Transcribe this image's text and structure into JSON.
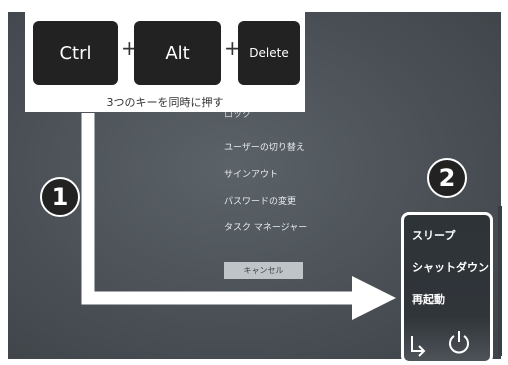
{
  "keys": {
    "ctrl": "Ctrl",
    "alt": "Alt",
    "delete": "Delete",
    "plus1": "+",
    "plus2": "+",
    "caption": "3つのキーを同時に押す"
  },
  "menu": {
    "items": [
      {
        "label": "ロック"
      },
      {
        "label": "ユーザーの切り替え"
      },
      {
        "label": "サインアウト"
      },
      {
        "label": "パスワードの変更"
      },
      {
        "label": "タスク マネージャー"
      }
    ],
    "cancel_label": "キャンセル"
  },
  "power_menu": {
    "items": [
      {
        "label": "スリープ"
      },
      {
        "label": "シャットダウン"
      },
      {
        "label": "再起動"
      }
    ]
  },
  "steps": {
    "step1": "1",
    "step2": "2"
  },
  "icons": [
    "accessibility-icon",
    "power-icon",
    "arrow-icon"
  ],
  "colors": {
    "screen_bg": "#4a5056",
    "panel_bg": "#2e3338",
    "key_bg": "#222222",
    "highlight": "#ffffff"
  }
}
